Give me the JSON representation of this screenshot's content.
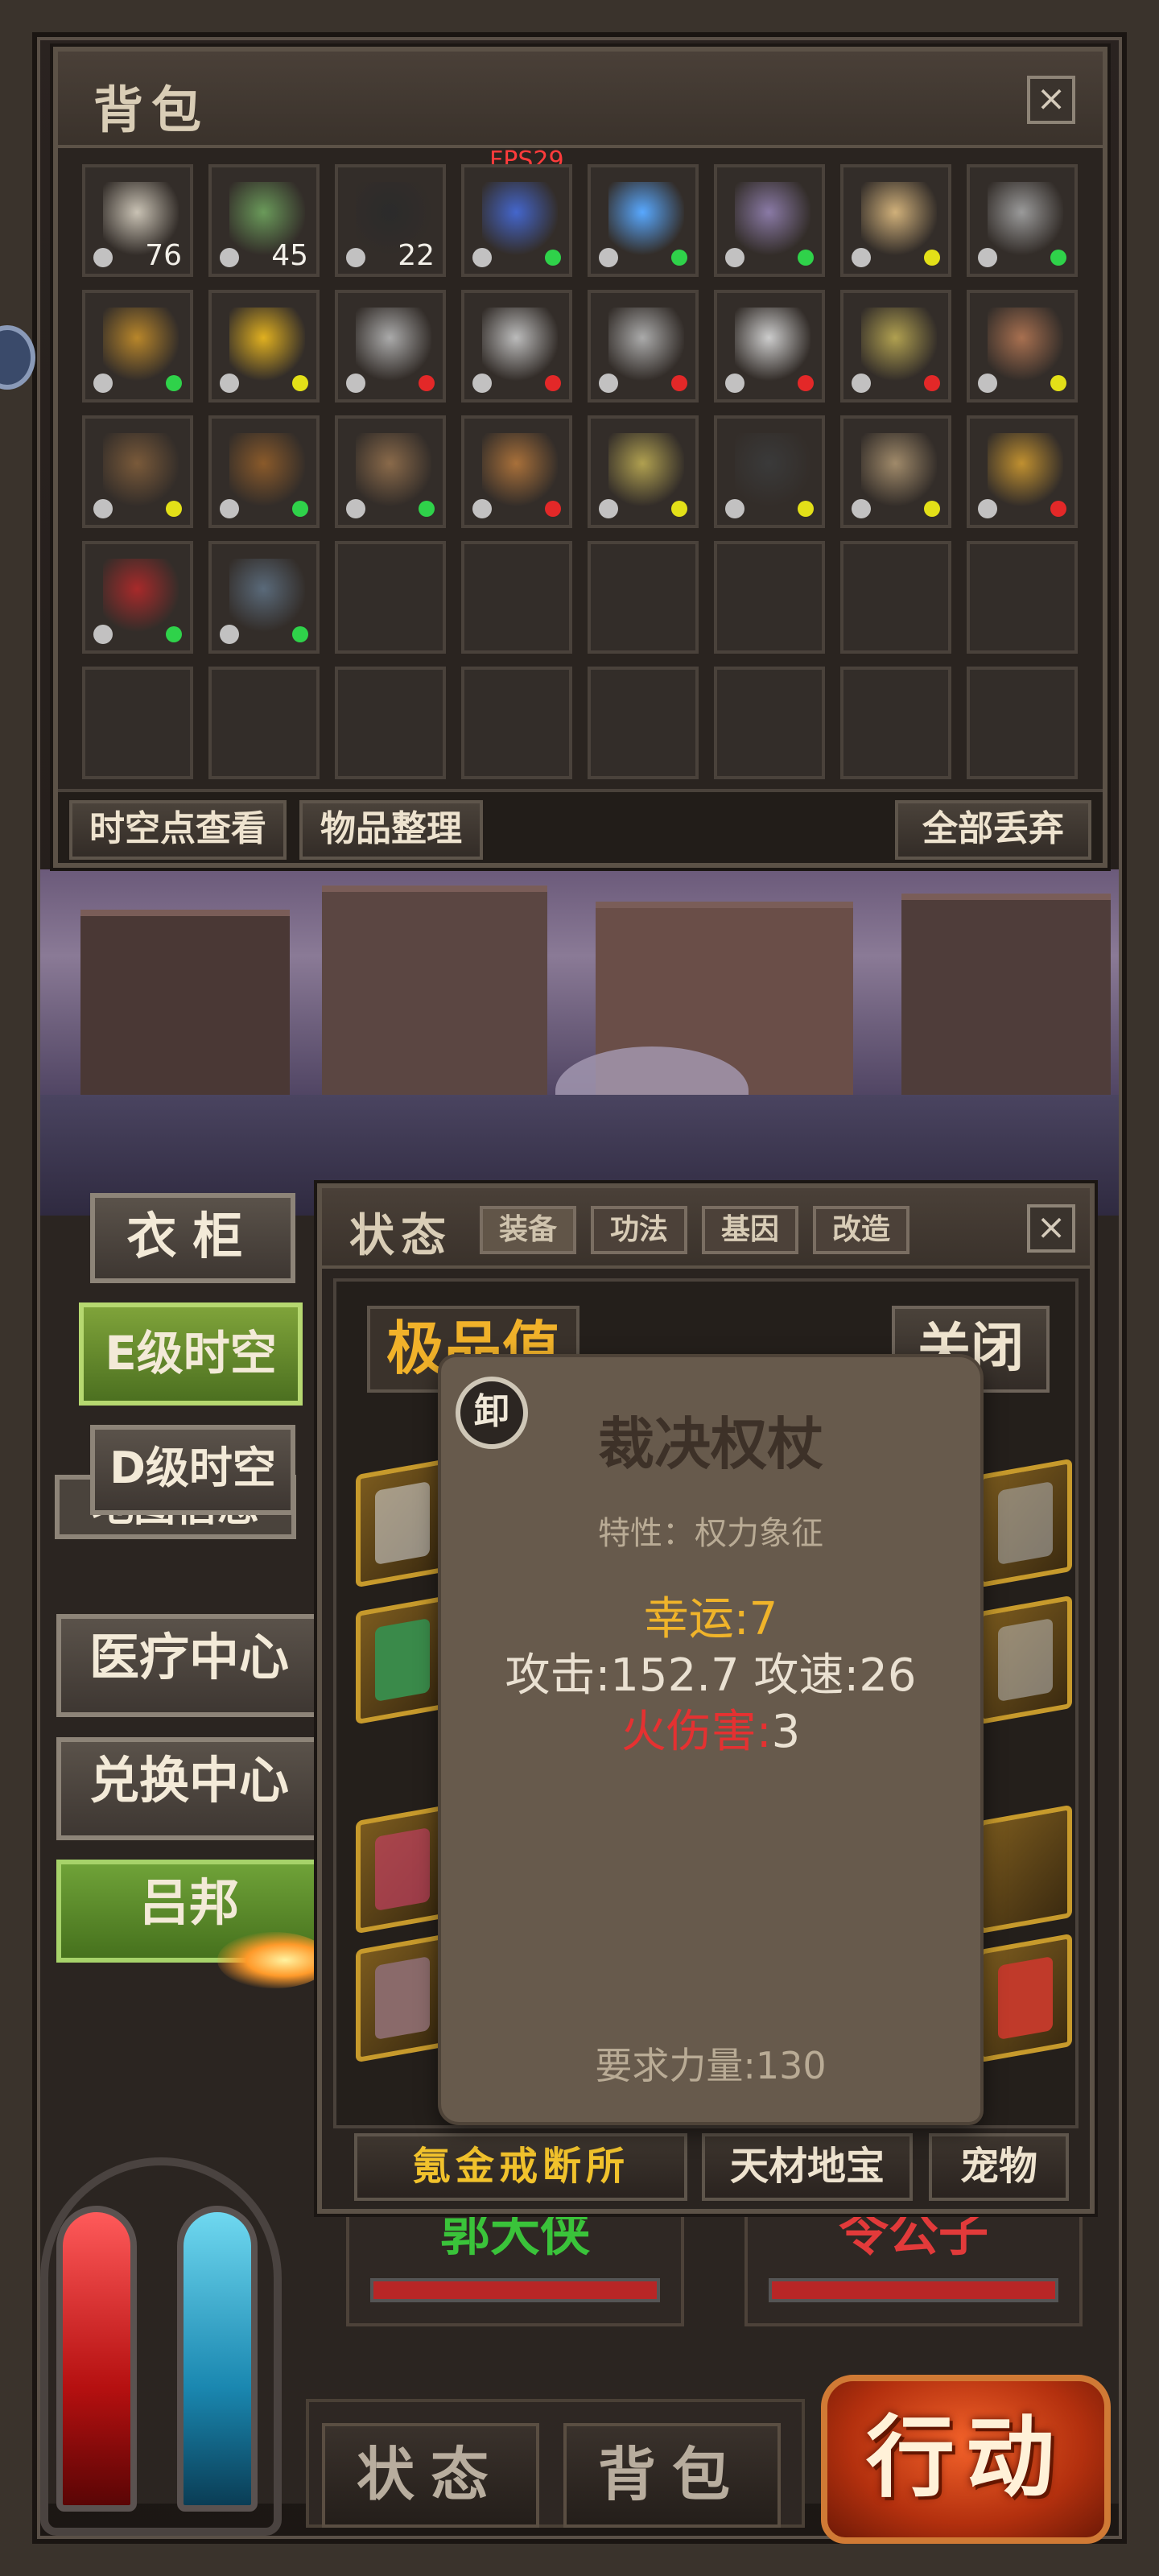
{
  "backpack": {
    "title": "背包",
    "close_label": "×",
    "fps": "FPS29",
    "rows": [
      [
        {
          "icon": "scroll-poster-icon",
          "count": "76",
          "dot": ""
        },
        {
          "icon": "green-bottle-icon",
          "count": "45",
          "dot": ""
        },
        {
          "icon": "camera-box-icon",
          "count": "22",
          "dot": ""
        },
        {
          "icon": "blue-flame-orb-icon",
          "count": "",
          "dot": "g"
        },
        {
          "icon": "blue-crystal-icon",
          "count": "",
          "dot": "g"
        },
        {
          "icon": "armor-chest-icon",
          "count": "",
          "dot": "g"
        },
        {
          "icon": "bracers-icon",
          "count": "",
          "dot": "y"
        },
        {
          "icon": "steel-helmet-icon",
          "count": "",
          "dot": "g"
        }
      ],
      [
        {
          "icon": "golden-mask-icon",
          "count": "",
          "dot": "g"
        },
        {
          "icon": "gold-medallion-icon",
          "count": "",
          "dot": "y"
        },
        {
          "icon": "curved-blade-icon",
          "count": "",
          "dot": "r"
        },
        {
          "icon": "scimitar-icon",
          "count": "",
          "dot": "r"
        },
        {
          "icon": "curved-sword-icon",
          "count": "",
          "dot": "r"
        },
        {
          "icon": "broad-saber-icon",
          "count": "",
          "dot": "r"
        },
        {
          "icon": "glaive-icon",
          "count": "",
          "dot": "r"
        },
        {
          "icon": "spear-icon",
          "count": "",
          "dot": "y"
        }
      ],
      [
        {
          "icon": "pike-icon",
          "count": "",
          "dot": "y"
        },
        {
          "icon": "twisted-staff-icon",
          "count": "",
          "dot": "g"
        },
        {
          "icon": "long-spear-icon",
          "count": "",
          "dot": "g"
        },
        {
          "icon": "ornate-scepter-icon",
          "count": "",
          "dot": "r"
        },
        {
          "icon": "halberd-icon",
          "count": "",
          "dot": "y"
        },
        {
          "icon": "segmented-rod-icon",
          "count": "",
          "dot": "y"
        },
        {
          "icon": "wolf-ring-icon",
          "count": "",
          "dot": "y"
        },
        {
          "icon": "ruby-ring-icon",
          "count": "",
          "dot": "r"
        }
      ],
      [
        {
          "icon": "red-belt-icon",
          "count": "",
          "dot": "g"
        },
        {
          "icon": "boots-icon",
          "count": "",
          "dot": "g"
        },
        null,
        null,
        null,
        null,
        null,
        null
      ],
      [
        null,
        null,
        null,
        null,
        null,
        null,
        null,
        null
      ]
    ],
    "footer": {
      "spacetime_view": "时空点查看",
      "sort_items": "物品整理",
      "discard_all": "全部丢弃"
    }
  },
  "side": {
    "wardrobe": "衣柜",
    "e_space": "E级时空",
    "d_space": "D级时空",
    "map_info": "地图信息",
    "medical": "医疗中心",
    "exchange": "兑换中心",
    "npc": "吕邦"
  },
  "status": {
    "title": "状态",
    "tabs": [
      "装备",
      "功法",
      "基因",
      "改造"
    ],
    "close_label": "×",
    "quality_label": "极品值",
    "close_btn": "关闭",
    "footer": {
      "forge": "氪金戒断所",
      "treasure": "天材地宝",
      "pet": "宠物"
    }
  },
  "tooltip": {
    "badge": "卸",
    "name": "裁决权杖",
    "feature": "特性：权力象征",
    "luck": "幸运:7",
    "attack": "攻击:152.7 攻速:26",
    "fire_key": "火伤害:",
    "fire_val": "3",
    "requirement": "要求力量:130"
  },
  "players": {
    "p1": "郭大侠",
    "p2": "令公子"
  },
  "bottom": {
    "status": "状态",
    "bag": "背包",
    "action": "行动"
  },
  "colors": {
    "gold": "#f1b22a",
    "fire": "#e53131",
    "dot_green": "#2fd24a",
    "dot_yellow": "#e3e018",
    "dot_red": "#e32828"
  }
}
